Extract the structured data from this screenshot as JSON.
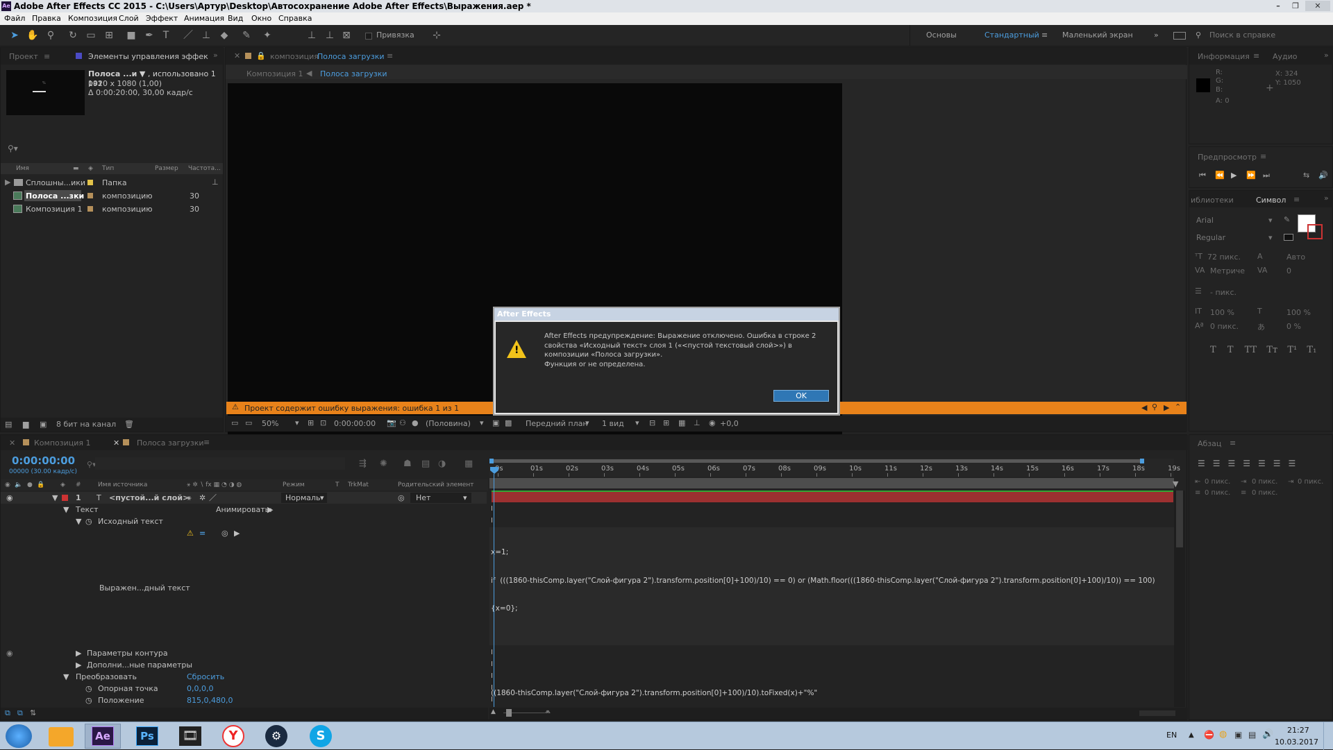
{
  "window": {
    "title": "Adobe After Effects CC 2015 - C:\\Users\\Артур\\Desktop\\Автосохранение Adobe After Effects\\Выражения.aep *",
    "app_icon": "Ae"
  },
  "menu": [
    "Файл",
    "Правка",
    "Композиция",
    "Слой",
    "Эффект",
    "Анимация",
    "Вид",
    "Окно",
    "Справка"
  ],
  "toolbar": {
    "snap_label": "Привязка",
    "workspaces": [
      "Основы",
      "Стандартный",
      "Маленький экран"
    ],
    "search_placeholder": "Поиск в справке"
  },
  "project": {
    "tabs": [
      "Проект",
      "Элементы управления эффек"
    ],
    "selected_name": "Полоса ...и",
    "selected_usage": ", использовано 1 раз",
    "selected_size": "1920 x 1080 (1,00)",
    "selected_duration": "Δ 0:00:20:00, 30,00 кадр/с",
    "columns": [
      "Имя",
      "Тип",
      "Размер",
      "Частота..."
    ],
    "items": [
      {
        "name": "Сплошны...ики",
        "type": "Папка",
        "rate": ""
      },
      {
        "name": "Полоса ...зки",
        "type": "композицию",
        "rate": "30"
      },
      {
        "name": "Композиция 1",
        "type": "композицию",
        "rate": "30"
      }
    ],
    "bpc": "8 бит на канал"
  },
  "comp_viewer": {
    "panel_label": "композиция",
    "panel_comp": "Полоса загрузки",
    "breadcrumbs": [
      "Композиция 1",
      "Полоса загрузки"
    ],
    "error_bar": "Проект содержит ошибку выражения: ошибка 1 из 1",
    "zoom": "50%",
    "timecode": "0:00:00:00",
    "resolution": "(Половина)",
    "view": "Передний план",
    "views_count": "1 вид",
    "exposure": "+0,0"
  },
  "dialog": {
    "title": "After Effects",
    "line1": "After Effects предупреждение: Выражение отключено. Ошибка в строке 2",
    "line2": "свойства «Исходный текст» слоя 1 («<пустой текстовый слой>») в",
    "line3": "композиции «Полоса загрузки».",
    "line4": "Функция or не определена.",
    "ok": "OK"
  },
  "info_panel": {
    "tabs": [
      "Информация",
      "Аудио"
    ],
    "r": "R:",
    "g": "G:",
    "b": "B:",
    "a": "A:  0",
    "x": "X: 324",
    "y": "Y: 1050"
  },
  "preview_panel": {
    "title": "Предпросмотр"
  },
  "char_panel": {
    "tabs": [
      "иблиотеки",
      "Символ"
    ],
    "font": "Arial",
    "style": "Regular",
    "size": "72 пикс.",
    "leading": "Авто",
    "kerning": "Метриче",
    "tracking": "0",
    "stroke": "- пикс.",
    "vscale": "100 %",
    "hscale": "100 %",
    "baseline": "0 пикс.",
    "tsume": "0 %",
    "styles": [
      "T",
      "T",
      "TT",
      "Tт",
      "T¹",
      "T₁"
    ]
  },
  "para_panel": {
    "title": "Абзац",
    "indents": [
      "0 пикс.",
      "0 пикс.",
      "0 пикс.",
      "0 пикс.",
      "0 пикс."
    ]
  },
  "timeline": {
    "tabs": [
      "Композиция 1",
      "Полоса загрузки"
    ],
    "timecode": "0:00:00:00",
    "frames": "00000 (30.00 кадр/с)",
    "columns": [
      "#",
      "Имя источника",
      "Режим",
      "T",
      "TrkMat",
      "Родительский элемент"
    ],
    "layer": {
      "num": "1",
      "name": "<пустой...й слой>",
      "mode": "Нормаль",
      "parent": "Нет"
    },
    "rows": {
      "text": "Текст",
      "animate": "Анимировать:",
      "source_text": "Исходный текст",
      "expr_label": "Выражен...дный текст",
      "path_opts": "Параметры контура",
      "more_opts": "Дополни...ные параметры",
      "transform": "Преобразовать",
      "reset": "Сбросить",
      "anchor": "Опорная точка",
      "anchor_val": "0,0,0,0",
      "position": "Положение",
      "position_val": "815,0,480,0"
    },
    "ruler": [
      "0s",
      "01s",
      "02s",
      "03s",
      "04s",
      "05s",
      "06s",
      "07s",
      "08s",
      "09s",
      "10s",
      "11s",
      "12s",
      "13s",
      "14s",
      "15s",
      "16s",
      "17s",
      "18s",
      "19s"
    ],
    "expression": [
      "x=1;",
      "if  (((1860-thisComp.layer(\"Слой-фигура 2\").transform.position[0]+100)/10) == 0) or (Math.floor(((1860-thisComp.layer(\"Слой-фигура 2\").transform.position[0]+100)/10)) == 100)",
      "{x=0};",
      "",
      "((1860-thisComp.layer(\"Слой-фигура 2\").transform.position[0]+100)/10).toFixed(x)+\"%\""
    ]
  },
  "taskbar": {
    "lang": "EN",
    "time": "21:27",
    "date": "10.03.2017",
    "apps": [
      "Ae",
      "Ps"
    ]
  }
}
